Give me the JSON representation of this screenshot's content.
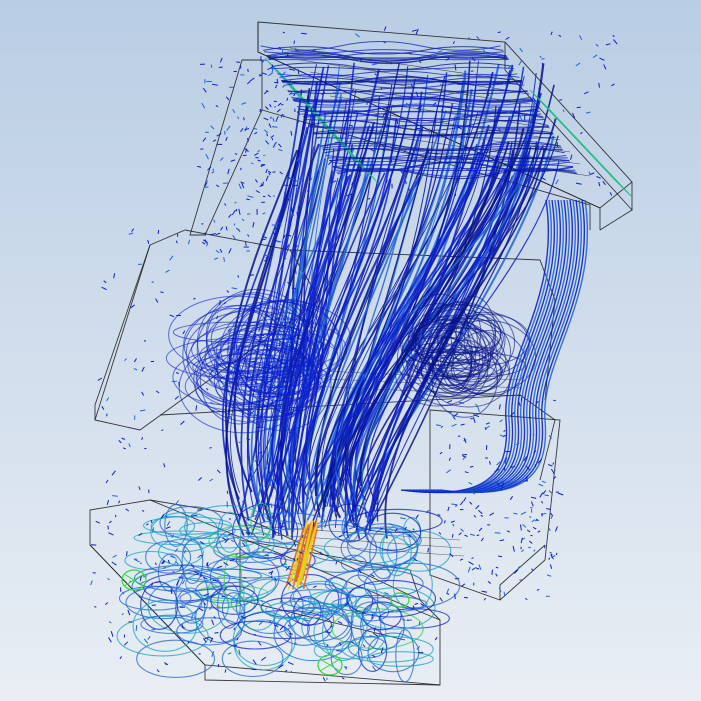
{
  "viewport": {
    "background_top": "#b9cde4",
    "background_bottom": "#e9eef4"
  },
  "colors": {
    "flow_primary": "#0a1fc8",
    "flow_dark": "#06128a",
    "flow_mid": "#1e63d8",
    "flow_cyan": "#1aa0c8",
    "flow_green": "#2fcf5a",
    "flow_yellow": "#e8d21a",
    "flow_orange": "#e5641a",
    "wireframe": "#1a1a1a",
    "fan_marker": "#2fdb2f"
  },
  "icons": {
    "fan_left": "fan-icon",
    "fan_bottom": "fan-icon"
  }
}
